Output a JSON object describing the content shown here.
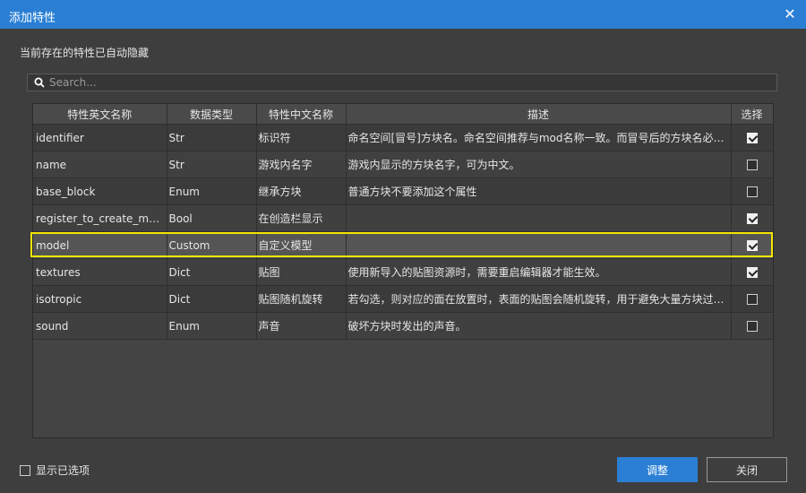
{
  "dialog": {
    "title": "添加特性",
    "hint": "当前存在的特性已自动隐藏"
  },
  "search": {
    "placeholder": "Search..."
  },
  "table": {
    "headers": [
      "特性英文名称",
      "数据类型",
      "特性中文名称",
      "描述",
      "选择"
    ],
    "rows": [
      {
        "en": "identifier",
        "type": "Str",
        "cn": "标识符",
        "desc": "命名空间[冒号]方块名。命名空间推荐与mod名称一致。而冒号后的方块名必…",
        "checked": true
      },
      {
        "en": "name",
        "type": "Str",
        "cn": "游戏内名字",
        "desc": "游戏内显示的方块名字，可为中文。",
        "checked": false
      },
      {
        "en": "base_block",
        "type": "Enum",
        "cn": "继承方块",
        "desc": "普通方块不要添加这个属性",
        "checked": false
      },
      {
        "en": "register_to_create_menu",
        "type": "Bool",
        "cn": "在创造栏显示",
        "desc": "",
        "checked": true
      },
      {
        "en": "model",
        "type": "Custom",
        "cn": "自定义模型",
        "desc": "",
        "checked": true
      },
      {
        "en": "textures",
        "type": "Dict",
        "cn": "贴图",
        "desc": "使用新导入的贴图资源时，需要重启编辑器才能生效。",
        "checked": true
      },
      {
        "en": "isotropic",
        "type": "Dict",
        "cn": "贴图随机旋转",
        "desc": "若勾选，则对应的面在放置时，表面的贴图会随机旋转，用于避免大量方块过…",
        "checked": false
      },
      {
        "en": "sound",
        "type": "Enum",
        "cn": "声音",
        "desc": "破坏方块时发出的声音。",
        "checked": false
      }
    ]
  },
  "footer": {
    "show_selected_label": "显示已选项",
    "adjust_label": "调整",
    "close_label": "关闭"
  },
  "colors": {
    "accent": "#2a7fd4",
    "highlight": "#f3e600"
  }
}
